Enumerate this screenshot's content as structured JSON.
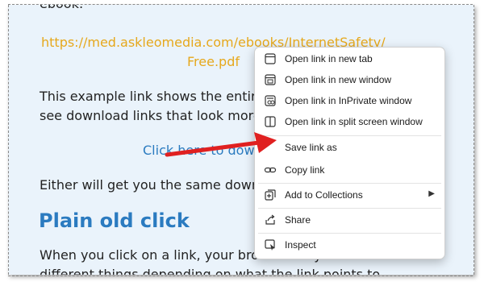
{
  "article": {
    "top_partial": "ebook:",
    "link_line1": "https://med.askleomedia.com/ebooks/InternetSafety/",
    "link_line2": "Free.pdf",
    "para1_line1": "This example link shows the entire",
    "para1_line2": "see download links that look more",
    "click_link": "Click here to dow",
    "para2": "Either will get you the same downlo",
    "heading": "Plain old click",
    "para3_line1": "When you click on a link, your browser may do several",
    "para3_line2": "different things depending on what the link points to"
  },
  "context_menu": {
    "items": [
      {
        "label": "Open link in new tab",
        "icon": "new-tab-icon"
      },
      {
        "label": "Open link in new window",
        "icon": "new-window-icon"
      },
      {
        "label": "Open link in InPrivate window",
        "icon": "inprivate-icon"
      },
      {
        "label": "Open link in split screen window",
        "icon": "split-screen-icon"
      },
      {
        "label": "Save link as",
        "icon": "none"
      },
      {
        "label": "Copy link",
        "icon": "link-icon"
      },
      {
        "label": "Add to Collections",
        "icon": "collections-icon",
        "submenu": true
      },
      {
        "label": "Share",
        "icon": "share-icon"
      },
      {
        "label": "Inspect",
        "icon": "inspect-icon"
      }
    ]
  },
  "annotation": {
    "arrow_color": "#e02020"
  },
  "colors": {
    "background": "#eaf3fb",
    "link_orange": "#e6a81c",
    "link_blue": "#2b7bc0"
  }
}
